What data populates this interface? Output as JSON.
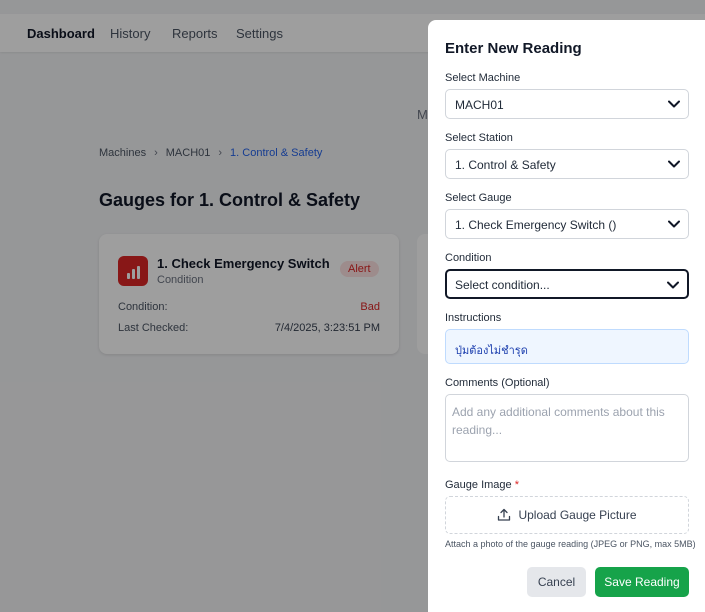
{
  "nav": {
    "items": [
      {
        "label": "Dashboard",
        "active": true
      },
      {
        "label": "History"
      },
      {
        "label": "Reports"
      },
      {
        "label": "Settings"
      }
    ]
  },
  "ghost_text": "M",
  "breadcrumb": [
    "Machines",
    "MACH01",
    "1. Control & Safety"
  ],
  "breadcrumb_sep": "›",
  "page_heading": "Gauges for 1. Control & Safety",
  "gauge_card": {
    "title": "1. Check Emergency Switch",
    "subtitle": "Condition",
    "badge": "Alert",
    "condition_label": "Condition:",
    "condition_value": "Bad",
    "last_checked_label": "Last Checked:",
    "last_checked_value": "7/4/2025, 3:23:51 PM"
  },
  "modal": {
    "title": "Enter New Reading",
    "machine_label": "Select Machine",
    "machine_value": "MACH01",
    "station_label": "Select Station",
    "station_value": "1. Control & Safety",
    "gauge_label": "Select Gauge",
    "gauge_value": "1. Check Emergency Switch ()",
    "condition_label": "Condition",
    "condition_value": "Select condition...",
    "instructions_label": "Instructions",
    "instructions_text": "ปุ่มต้องไม่ชำรุด",
    "comments_label": "Comments (Optional)",
    "comments_placeholder": "Add any additional comments about this reading...",
    "image_label": "Gauge Image",
    "required_mark": "*",
    "upload_label": "Upload Gauge Picture",
    "upload_hint": "Attach a photo of the gauge reading (JPEG or PNG, max 5MB)",
    "cancel_label": "Cancel",
    "save_label": "Save Reading"
  },
  "colors": {
    "accent": "#2563eb",
    "alert": "#dc2626",
    "save": "#16a34a"
  },
  "icons": [
    "chevron-down-icon",
    "bar-chart-icon",
    "upload-icon"
  ]
}
